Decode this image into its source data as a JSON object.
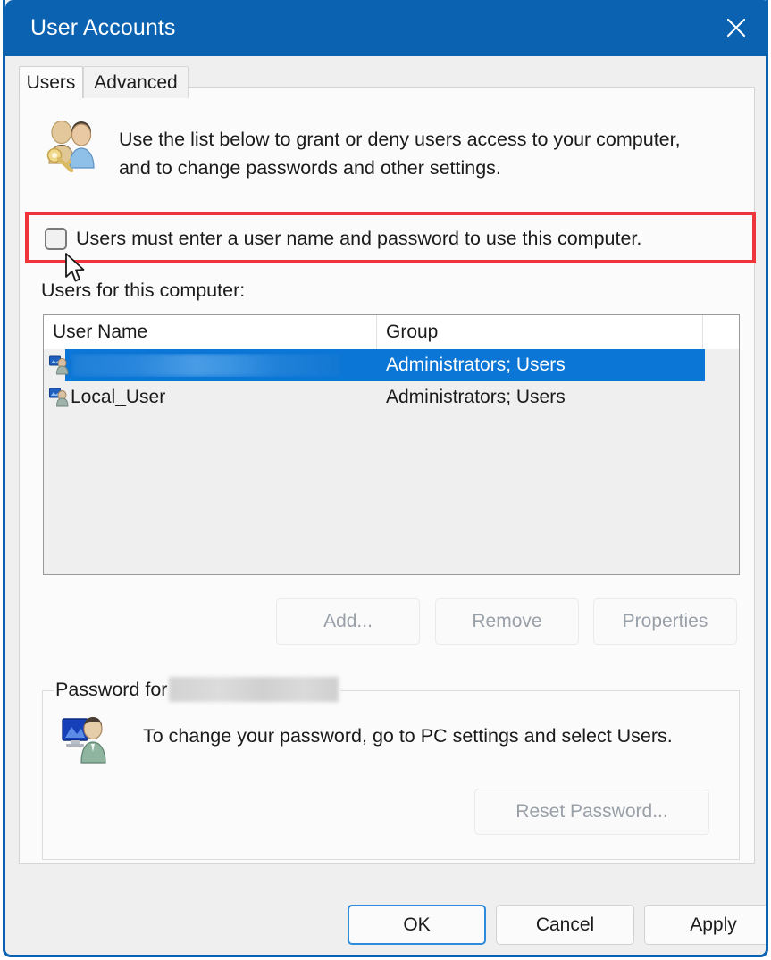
{
  "window": {
    "title": "User Accounts",
    "close_icon": "close-icon",
    "accent_color": "#0a62b0",
    "highlight_color": "#f0343c",
    "selection_color": "#0b76d6"
  },
  "tabs": [
    {
      "label": "Users",
      "active": true
    },
    {
      "label": "Advanced",
      "active": false
    }
  ],
  "description": {
    "icon": "users-key-icon",
    "line1": "Use the list below to grant or deny users access to your computer,",
    "line2": "and to change passwords and other settings."
  },
  "require_password_checkbox": {
    "label": "Users must enter a user name and password to use this computer.",
    "checked": false,
    "highlighted": true
  },
  "users_list": {
    "caption": "Users for this computer:",
    "columns": [
      "User Name",
      "Group",
      ""
    ],
    "rows": [
      {
        "icon": "user-icon",
        "name": "",
        "name_redacted": true,
        "group": "Administrators; Users",
        "selected": true
      },
      {
        "icon": "user-icon",
        "name": "Local_User",
        "name_redacted": false,
        "group": "Administrators; Users",
        "selected": false
      }
    ]
  },
  "list_actions": [
    {
      "label": "Add...",
      "enabled": false
    },
    {
      "label": "Remove",
      "enabled": false
    },
    {
      "label": "Properties",
      "enabled": false
    }
  ],
  "password_group": {
    "legend": "Password for",
    "legend_redacted": true,
    "icon": "user-monitor-icon",
    "text": "To change your password, go to PC settings and select Users.",
    "reset_button": {
      "label": "Reset Password...",
      "enabled": false
    }
  },
  "dialog_buttons": [
    {
      "label": "OK",
      "default": true
    },
    {
      "label": "Cancel",
      "default": false
    },
    {
      "label": "Apply",
      "default": false
    }
  ],
  "cursor": {
    "icon": "mouse-pointer-icon"
  }
}
